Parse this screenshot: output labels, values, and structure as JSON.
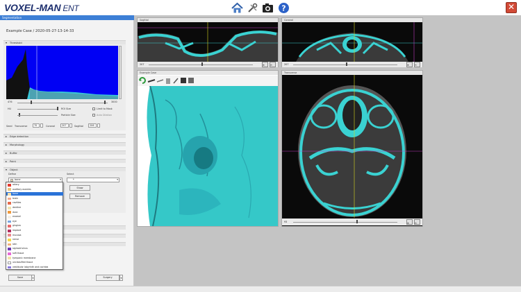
{
  "app": {
    "title": "VOXEL-MAN",
    "subtitle": "ENT"
  },
  "left": {
    "segmentation_label": "Segmentation",
    "case_name": "Example Case / 2020-05-27-13-14-33",
    "threshold": {
      "label": "Threshold",
      "min": "476",
      "max": "3000",
      "hu_label": "HU",
      "hu_value": "%",
      "roi_size_label": "ROI Size",
      "particle_size_label": "Particle Size",
      "limit_mask_label": "Limit to Mask",
      "auto_dilation_label": "Auto Dilation",
      "seed_label": "Seed",
      "transverse_label": "Transverse",
      "transverse_value": "70",
      "coronal_label": "Coronal",
      "coronal_value": "207",
      "sagittal_label": "Sagittal",
      "sagittal_value": "206"
    },
    "sections": [
      "Edge detection",
      "Morphology",
      "Buffer",
      "Paint",
      "Object"
    ],
    "object": {
      "define_label": "Define",
      "select_label": "Select",
      "define_value": "bone",
      "select_value": "*",
      "show_label": "Show",
      "remove_label": "Remove"
    },
    "list": [
      {
        "name": "artery",
        "color": "#e23a2f"
      },
      {
        "name": "auditory ossicles",
        "color": "#e8c27c"
      },
      {
        "name": "bone",
        "color": "#f0dcaa"
      },
      {
        "name": "brain",
        "color": "#f4a98c"
      },
      {
        "name": "cavities",
        "color": "#e56a4a"
      },
      {
        "name": "dentine",
        "color": "#f0e3b0"
      },
      {
        "name": "dura",
        "color": "#f09a3c"
      },
      {
        "name": "enamel",
        "color": "#f5f0e6"
      },
      {
        "name": "eye",
        "color": "#7aa6e0"
      },
      {
        "name": "gingiva",
        "color": "#e86a6a"
      },
      {
        "name": "implant",
        "color": "#b33060"
      },
      {
        "name": "mucosa",
        "color": "#ec8a90"
      },
      {
        "name": "nerve",
        "color": "#f5d94a"
      },
      {
        "name": "skin",
        "color": "#f2b27a"
      },
      {
        "name": "sigmoid sinus",
        "color": "#6b3ab5"
      },
      {
        "name": "soft tissue",
        "color": "#e86ad6"
      },
      {
        "name": "tympanic membrane",
        "color": "#f3e2a8"
      },
      {
        "name": "unclassified tissue",
        "color": "#ffffff"
      },
      {
        "name": "vestibular labyrinth and cochlea",
        "color": "#8a7ae0"
      }
    ],
    "bottom": {
      "save_label": "Save",
      "surgery_label": "Surgery"
    }
  },
  "viewers": {
    "sagittal": {
      "title": "Sagittal",
      "value": "207"
    },
    "coronal": {
      "title": "Coronal",
      "value": "207"
    },
    "three_d": {
      "title": "Example Case"
    },
    "transverse": {
      "title": "Transverse",
      "value": "93"
    }
  },
  "colors": {
    "accent": "#3d7fd6",
    "segment": "#3ad2d2",
    "histogram": "#0000f4"
  }
}
